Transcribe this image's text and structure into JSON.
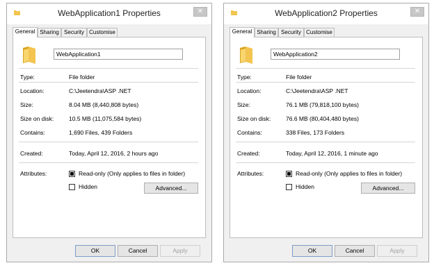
{
  "windows": [
    {
      "title": "WebApplication1 Properties",
      "tabs": [
        "General",
        "Sharing",
        "Security",
        "Customise"
      ],
      "name": "WebApplication1",
      "type_label": "Type:",
      "type_value": "File folder",
      "location_label": "Location:",
      "location_value": "C:\\Jeetendra\\ASP .NET",
      "size_label": "Size:",
      "size_value": "8.04 MB (8,440,808 bytes)",
      "size_on_disk_label": "Size on disk:",
      "size_on_disk_value": "10.5 MB (11,075,584 bytes)",
      "contains_label": "Contains:",
      "contains_value": "1,690 Files, 439 Folders",
      "created_label": "Created:",
      "created_value": "Today, April 12, 2016, 2 hours ago",
      "attributes_label": "Attributes:",
      "readonly_label": "Read-only (Only applies to files in folder)",
      "hidden_label": "Hidden",
      "advanced_label": "Advanced...",
      "ok_label": "OK",
      "cancel_label": "Cancel",
      "apply_label": "Apply"
    },
    {
      "title": "WebApplication2 Properties",
      "tabs": [
        "General",
        "Sharing",
        "Security",
        "Customise"
      ],
      "name": "WebApplication2",
      "type_label": "Type:",
      "type_value": "File folder",
      "location_label": "Location:",
      "location_value": "C:\\Jeetendra\\ASP .NET",
      "size_label": "Size:",
      "size_value": "76.1 MB (79,818,100 bytes)",
      "size_on_disk_label": "Size on disk:",
      "size_on_disk_value": "76.6 MB (80,404,480 bytes)",
      "contains_label": "Contains:",
      "contains_value": "338 Files, 173 Folders",
      "created_label": "Created:",
      "created_value": "Today, April 12, 2016, 1 minute ago",
      "attributes_label": "Attributes:",
      "readonly_label": "Read-only (Only applies to files in folder)",
      "hidden_label": "Hidden",
      "advanced_label": "Advanced...",
      "ok_label": "OK",
      "cancel_label": "Cancel",
      "apply_label": "Apply"
    }
  ],
  "icons": {
    "close": "close-icon",
    "folder": "folder-icon"
  },
  "colors": {
    "folder": "#f3c44f",
    "folder_dark": "#d9a520",
    "window_bg": "#f0f0f0"
  }
}
